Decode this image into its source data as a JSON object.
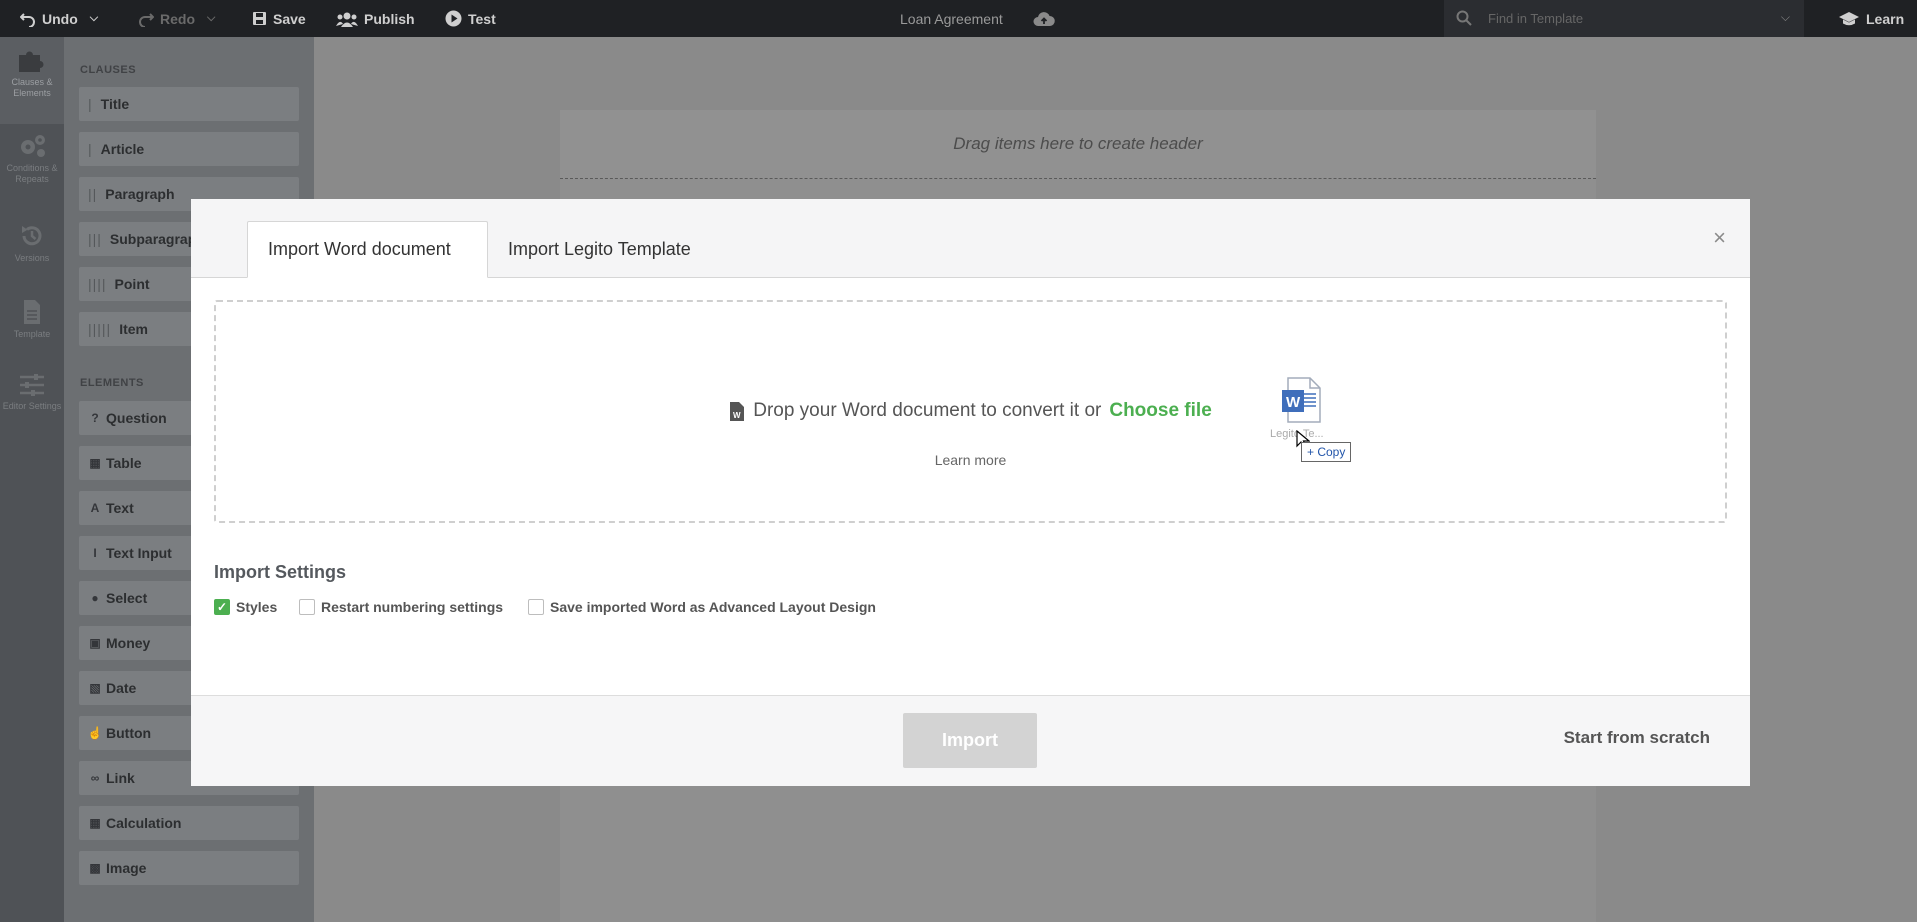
{
  "toolbar": {
    "undo": "Undo",
    "redo": "Redo",
    "save": "Save",
    "publish": "Publish",
    "test": "Test",
    "doc_title": "Loan Agreement",
    "search_placeholder": "Find in Template",
    "learn": "Learn"
  },
  "rail": {
    "clauses": "Clauses & Elements",
    "conditions": "Conditions & Repeats",
    "versions": "Versions",
    "template": "Template",
    "editor_settings": "Editor Settings"
  },
  "palette": {
    "clauses_title": "CLAUSES",
    "clauses": [
      "Title",
      "Article",
      "Paragraph",
      "Subparagraph",
      "Point",
      "Item"
    ],
    "elements_title": "ELEMENTS",
    "elements": [
      "Question",
      "Table",
      "Text",
      "Text Input",
      "Select",
      "Money",
      "Date",
      "Button",
      "Link",
      "Calculation",
      "Image"
    ]
  },
  "canvas": {
    "header_hint": "Drag items here to create header"
  },
  "modal": {
    "tabs": [
      "Import Word document",
      "Import Legito Template"
    ],
    "active_tab": 0,
    "close": "×",
    "drop_text": "Drop your Word document to convert it or",
    "choose_file": "Choose file",
    "learn_more": "Learn more",
    "drag_file_label": "Legito Te...",
    "copy_badge": "+ Copy",
    "settings_title": "Import Settings",
    "settings": [
      {
        "label": "Styles",
        "checked": true
      },
      {
        "label": "Restart numbering settings",
        "checked": false
      },
      {
        "label": "Save imported Word as Advanced Layout Design",
        "checked": false
      }
    ],
    "import_button": "Import",
    "start_from_scratch": "Start from scratch"
  },
  "colors": {
    "accent_green": "#4caf50",
    "topbar": "#1f2124",
    "word_blue": "#2b5fb4"
  }
}
